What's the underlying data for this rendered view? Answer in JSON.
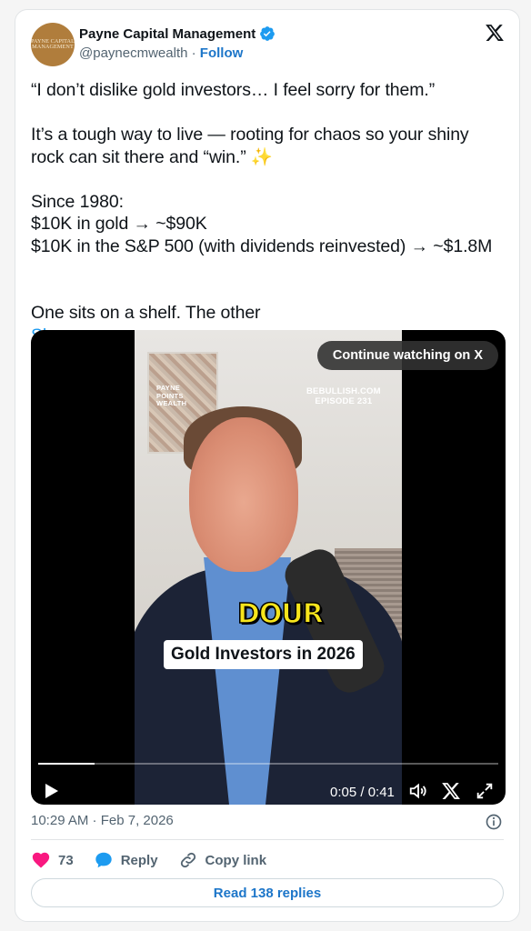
{
  "author": {
    "avatar_text": "PAYNE CAPITAL MANAGEMENT",
    "name": "Payne Capital Management",
    "handle": "@paynecmwealth",
    "separator": "·",
    "follow_label": "Follow"
  },
  "tweet": {
    "line1": "“I don’t dislike gold investors… I feel sorry for them.”",
    "para2": "It’s a tough way to live — rooting for chaos so your shiny rock can sit there and “win.” ✨",
    "since_1": "Since 1980:",
    "since_2": "$10K in gold → ~$90K",
    "since_3": "$10K in the S&P 500 (with dividends reinvested) → ~$1.8M",
    "last_line": "One sits on a shelf. The other",
    "show_more": "Show more"
  },
  "video": {
    "continue_label": "Continue watching on X",
    "watermark_left": "PAYNE\nPOINTS\nWEALTH",
    "watermark_right": "BEBULLISH.COM\nEPISODE 231",
    "caption_word": "DOUR",
    "caption_text": "Gold Investors in 2026",
    "time": "0:05 / 0:41",
    "progress": 0.122
  },
  "meta": {
    "timestamp": "10:29 AM · Feb 7, 2026"
  },
  "actions": {
    "likes": "73",
    "reply_label": "Reply",
    "copy_label": "Copy link",
    "read_replies": "Read 138 replies"
  },
  "colors": {
    "link_blue": "#1d9bf0",
    "follow_blue": "#1d76c9",
    "like_pink": "#f91880",
    "avatar_gold": "#b07d3c"
  },
  "icons": [
    "verified-badge-icon",
    "x-logo-icon",
    "play-icon",
    "volume-icon",
    "x-small-icon",
    "fullscreen-icon",
    "info-icon",
    "heart-icon",
    "reply-bubble-icon",
    "link-icon"
  ]
}
